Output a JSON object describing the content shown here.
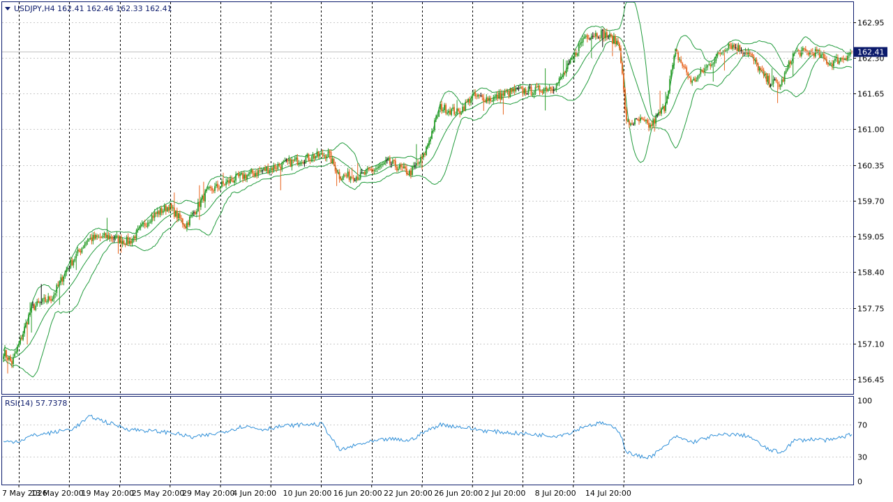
{
  "symbol_header": "USDJPY,H4  162.41 162.46 162.33 162.41",
  "indicator_header": "RSI(14) 57.7378",
  "current_price_label": "162.41",
  "colors": {
    "frame": "#0b1a6b",
    "bull": "#2a9d2a",
    "bear": "#e8631c",
    "doji": "#000000",
    "bands": "#1f9a3a",
    "rsi": "#2f8fd8",
    "grid": "#c8c8c8",
    "price_tag_bg": "#0b1a6b",
    "price_tag_fg": "#ffffff"
  },
  "chart_data": [
    {
      "type": "candlestick",
      "series": [
        {
          "name": "USDJPY,H4"
        }
      ],
      "ylim": [
        156.2,
        163.3
      ],
      "y_ticks": [
        {
          "value": 156.45,
          "label": "156.45"
        },
        {
          "value": 157.1,
          "label": "157.10"
        },
        {
          "value": 157.75,
          "label": "157.75"
        },
        {
          "value": 158.4,
          "label": "158.40"
        },
        {
          "value": 159.05,
          "label": "159.05"
        },
        {
          "value": 159.7,
          "label": "159.70"
        },
        {
          "value": 160.35,
          "label": "160.35"
        },
        {
          "value": 161.0,
          "label": "161.00"
        },
        {
          "value": 161.65,
          "label": "161.65"
        },
        {
          "value": 162.3,
          "label": "162.30"
        },
        {
          "value": 162.95,
          "label": "162.95"
        }
      ],
      "current_price": 162.41,
      "x_labels": [
        "7 May 2026",
        "13 May 20:00",
        "19 May 20:00",
        "25 May 20:00",
        "29 May 20:00",
        "4 Jun 20:00",
        "10 Jun 20:00",
        "16 Jun 20:00",
        "22 Jun 20:00",
        "26 Jun 20:00",
        "2 Jul 20:00",
        "8 Jul 20:00",
        "14 Jul 20:00"
      ],
      "overlays": "Bollinger Bands",
      "grid": true,
      "anchors": [
        [
          0,
          156.95
        ],
        [
          6,
          156.75
        ],
        [
          12,
          157.15
        ],
        [
          20,
          157.75
        ],
        [
          35,
          157.95
        ],
        [
          45,
          158.45
        ],
        [
          60,
          159.0
        ],
        [
          75,
          159.05
        ],
        [
          90,
          158.95
        ],
        [
          105,
          159.4
        ],
        [
          118,
          159.6
        ],
        [
          130,
          159.25
        ],
        [
          145,
          159.85
        ],
        [
          165,
          160.1
        ],
        [
          185,
          160.25
        ],
        [
          205,
          160.4
        ],
        [
          220,
          160.5
        ],
        [
          232,
          160.55
        ],
        [
          240,
          160.15
        ],
        [
          255,
          160.15
        ],
        [
          275,
          160.4
        ],
        [
          290,
          160.2
        ],
        [
          300,
          160.5
        ],
        [
          312,
          161.4
        ],
        [
          325,
          161.3
        ],
        [
          335,
          161.6
        ],
        [
          348,
          161.55
        ],
        [
          365,
          161.7
        ],
        [
          380,
          161.7
        ],
        [
          395,
          161.8
        ],
        [
          405,
          162.2
        ],
        [
          415,
          162.7
        ],
        [
          428,
          162.75
        ],
        [
          440,
          162.55
        ],
        [
          445,
          161.1
        ],
        [
          455,
          161.15
        ],
        [
          462,
          161.05
        ],
        [
          472,
          161.4
        ],
        [
          480,
          162.4
        ],
        [
          492,
          161.85
        ],
        [
          505,
          162.2
        ],
        [
          518,
          162.55
        ],
        [
          532,
          162.4
        ],
        [
          545,
          161.9
        ],
        [
          555,
          161.8
        ],
        [
          565,
          162.4
        ],
        [
          580,
          162.4
        ],
        [
          590,
          162.2
        ],
        [
          600,
          162.3
        ],
        [
          606,
          162.41
        ]
      ],
      "rsi": {
        "name": "RSI(14)",
        "value": 57.7378,
        "levels": [
          {
            "value": 100,
            "label": "100"
          },
          {
            "value": 70,
            "label": "70"
          },
          {
            "value": 30,
            "label": "30"
          },
          {
            "value": 0,
            "label": "0"
          }
        ],
        "ylim": [
          0,
          100
        ],
        "anchors": [
          [
            0,
            48
          ],
          [
            12,
            50
          ],
          [
            20,
            56
          ],
          [
            35,
            60
          ],
          [
            50,
            65
          ],
          [
            62,
            80
          ],
          [
            75,
            72
          ],
          [
            90,
            64
          ],
          [
            105,
            62
          ],
          [
            120,
            60
          ],
          [
            135,
            54
          ],
          [
            150,
            58
          ],
          [
            172,
            68
          ],
          [
            185,
            64
          ],
          [
            200,
            68
          ],
          [
            215,
            70
          ],
          [
            228,
            70
          ],
          [
            240,
            38
          ],
          [
            255,
            46
          ],
          [
            275,
            52
          ],
          [
            290,
            50
          ],
          [
            300,
            60
          ],
          [
            312,
            70
          ],
          [
            330,
            66
          ],
          [
            345,
            62
          ],
          [
            360,
            60
          ],
          [
            375,
            58
          ],
          [
            395,
            56
          ],
          [
            405,
            60
          ],
          [
            415,
            68
          ],
          [
            428,
            72
          ],
          [
            440,
            62
          ],
          [
            445,
            36
          ],
          [
            455,
            30
          ],
          [
            462,
            30
          ],
          [
            472,
            42
          ],
          [
            480,
            55
          ],
          [
            492,
            48
          ],
          [
            505,
            55
          ],
          [
            518,
            58
          ],
          [
            532,
            56
          ],
          [
            545,
            40
          ],
          [
            555,
            35
          ],
          [
            565,
            50
          ],
          [
            580,
            52
          ],
          [
            590,
            50
          ],
          [
            600,
            55
          ],
          [
            606,
            57.7
          ]
        ]
      }
    }
  ]
}
